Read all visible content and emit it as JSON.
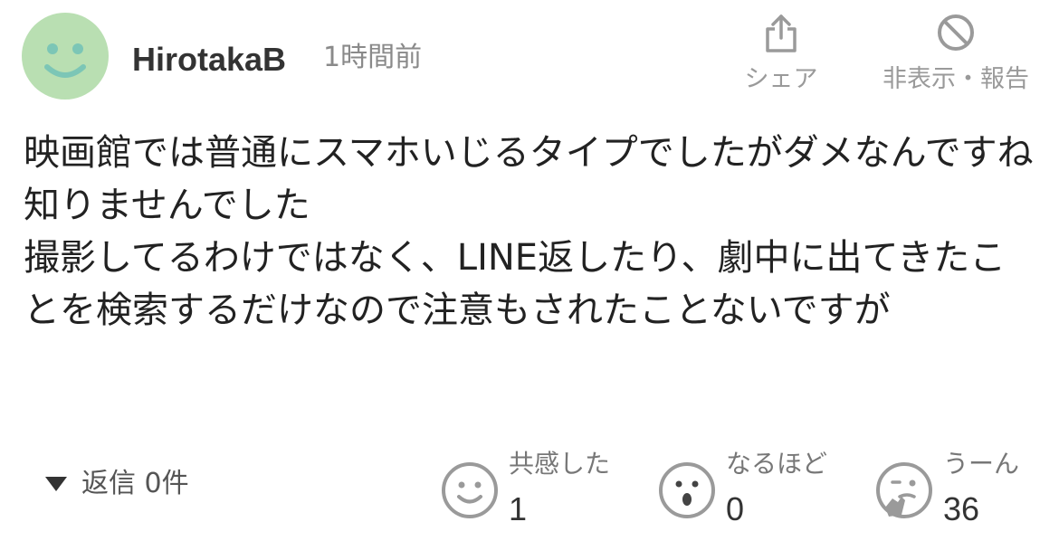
{
  "comment": {
    "username": "HirotakaB",
    "time": "1時間前",
    "body": "映画館では普通にスマホいじるタイプでしたがダメなんですね知りませんでした\n撮影してるわけではなく、LINE返したり、劇中に出てきたことを検索するだけなので注意もされたことないですが"
  },
  "actions": {
    "share": {
      "label": "シェア",
      "icon": "share-icon"
    },
    "report": {
      "label": "非表示・報告",
      "icon": "prohibit-icon"
    }
  },
  "replies": {
    "label": "返信 0件",
    "icon": "triangle-down-icon"
  },
  "reactions": [
    {
      "label": "共感した",
      "count": "1",
      "icon": "smile-face-icon"
    },
    {
      "label": "なるほど",
      "count": "0",
      "icon": "surprised-face-icon"
    },
    {
      "label": "うーん",
      "count": "36",
      "icon": "thinking-face-icon"
    }
  ],
  "colors": {
    "avatar_bg": "#b9dfb2",
    "avatar_face": "#7cc6b6",
    "muted": "#9a9a9a",
    "text": "#222222"
  }
}
